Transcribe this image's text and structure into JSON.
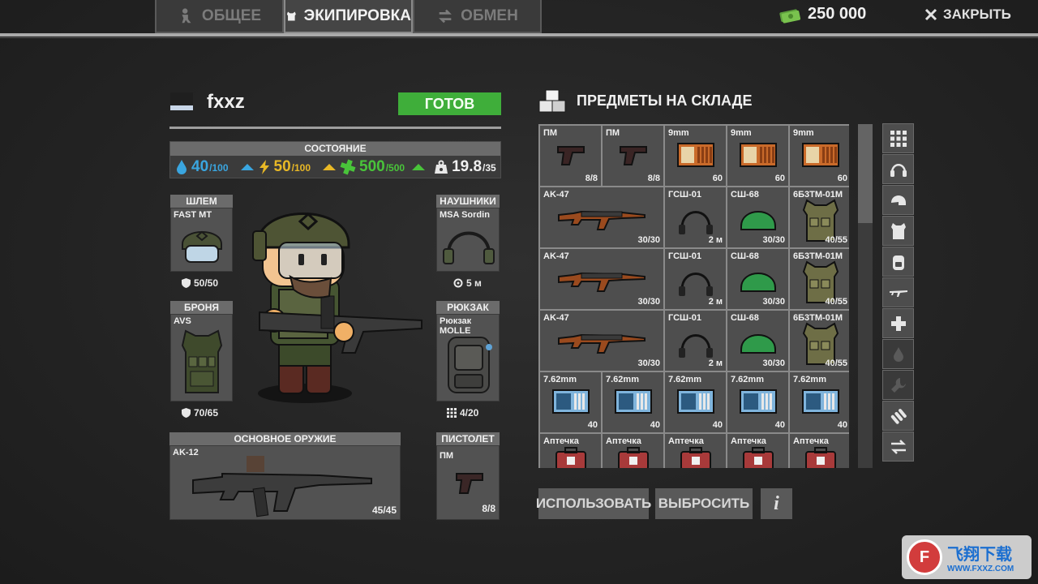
{
  "tabs": [
    {
      "label": "ОБЩЕЕ",
      "icon": "soldier-icon",
      "active": false
    },
    {
      "label": "ЭКИПИРОВКА",
      "icon": "vest-icon",
      "active": true
    },
    {
      "label": "ОБМЕН",
      "icon": "swap-icon",
      "active": false
    }
  ],
  "money": {
    "amount": "250 000",
    "icon": "cash-icon"
  },
  "close_label": "ЗАКРЫТЬ",
  "player": {
    "name": "fxxz",
    "ready_label": "ГОТОВ"
  },
  "status": {
    "title": "СОСТОЯНИЕ",
    "water": {
      "value": "40",
      "max": "/100",
      "color": "#3aa6e0"
    },
    "energy": {
      "value": "50",
      "max": "/100",
      "color": "#e8b826"
    },
    "health": {
      "value": "500",
      "max": "/500",
      "color": "#49c43a"
    },
    "weight": {
      "value": "19.8",
      "max": "/35"
    }
  },
  "slots": {
    "helmet": {
      "title": "ШЛЕМ",
      "item": "FAST MT",
      "value": "50/50"
    },
    "armor": {
      "title": "БРОНЯ",
      "item": "AVS",
      "value": "70/65"
    },
    "headphones": {
      "title": "НАУШНИКИ",
      "item": "MSA Sordin",
      "value": "5 м"
    },
    "backpack": {
      "title": "РЮКЗАК",
      "item": "Рюкзак MOLLE",
      "value": "4/20"
    },
    "primary": {
      "title": "ОСНОВНОЕ ОРУЖИЕ",
      "item": "AK-12",
      "value": "45/45"
    },
    "pistol": {
      "title": "ПИСТОЛЕТ",
      "item": "ПМ",
      "value": "8/8"
    }
  },
  "warehouse": {
    "title": "ПРЕДМЕТЫ НА СКЛАДЕ",
    "rows": [
      [
        {
          "name": "ПМ",
          "count": "8/8",
          "icon": "pistol"
        },
        {
          "name": "ПМ",
          "count": "8/8",
          "icon": "pistol"
        },
        {
          "name": "9mm",
          "count": "60",
          "icon": "ammo-orange"
        },
        {
          "name": "9mm",
          "count": "60",
          "icon": "ammo-orange"
        },
        {
          "name": "9mm",
          "count": "60",
          "icon": "ammo-orange"
        }
      ],
      [
        {
          "name": "AK-47",
          "count": "30/30",
          "icon": "rifle",
          "wide": true
        },
        {
          "name": "ГСШ-01",
          "count": "2 м",
          "icon": "headphones"
        },
        {
          "name": "СШ-68",
          "count": "30/30",
          "icon": "helmet"
        },
        {
          "name": "6Б3ТМ-01М",
          "count": "40/55",
          "icon": "vest"
        }
      ],
      [
        {
          "name": "AK-47",
          "count": "30/30",
          "icon": "rifle",
          "wide": true
        },
        {
          "name": "ГСШ-01",
          "count": "2 м",
          "icon": "headphones"
        },
        {
          "name": "СШ-68",
          "count": "30/30",
          "icon": "helmet"
        },
        {
          "name": "6Б3ТМ-01М",
          "count": "40/55",
          "icon": "vest"
        }
      ],
      [
        {
          "name": "AK-47",
          "count": "30/30",
          "icon": "rifle",
          "wide": true
        },
        {
          "name": "ГСШ-01",
          "count": "2 м",
          "icon": "headphones"
        },
        {
          "name": "СШ-68",
          "count": "30/30",
          "icon": "helmet"
        },
        {
          "name": "6Б3ТМ-01М",
          "count": "40/55",
          "icon": "vest"
        }
      ],
      [
        {
          "name": "7.62mm",
          "count": "40",
          "icon": "ammo-blue"
        },
        {
          "name": "7.62mm",
          "count": "40",
          "icon": "ammo-blue"
        },
        {
          "name": "7.62mm",
          "count": "40",
          "icon": "ammo-blue"
        },
        {
          "name": "7.62mm",
          "count": "40",
          "icon": "ammo-blue"
        },
        {
          "name": "7.62mm",
          "count": "40",
          "icon": "ammo-blue"
        }
      ],
      [
        {
          "name": "Аптечка",
          "count": "",
          "icon": "medkit"
        },
        {
          "name": "Аптечка",
          "count": "",
          "icon": "medkit"
        },
        {
          "name": "Аптечка",
          "count": "",
          "icon": "medkit"
        },
        {
          "name": "Аптечка",
          "count": "",
          "icon": "medkit"
        },
        {
          "name": "Аптечка",
          "count": "",
          "icon": "medkit"
        }
      ]
    ]
  },
  "filters": [
    "grid-icon",
    "headphones-icon",
    "helmet-icon",
    "armor-icon",
    "backpack-icon",
    "rifle-icon",
    "medkit-icon",
    "water-icon",
    "wrench-icon",
    "ammo-icon",
    "swap-icon"
  ],
  "actions": {
    "use_label": "ИСПОЛЬЗОВАТЬ",
    "drop_label": "ВЫБРОСИТЬ",
    "info_label": "i"
  },
  "watermark": {
    "text": "飞翔下载",
    "url": "WWW.FXXZ.COM"
  }
}
